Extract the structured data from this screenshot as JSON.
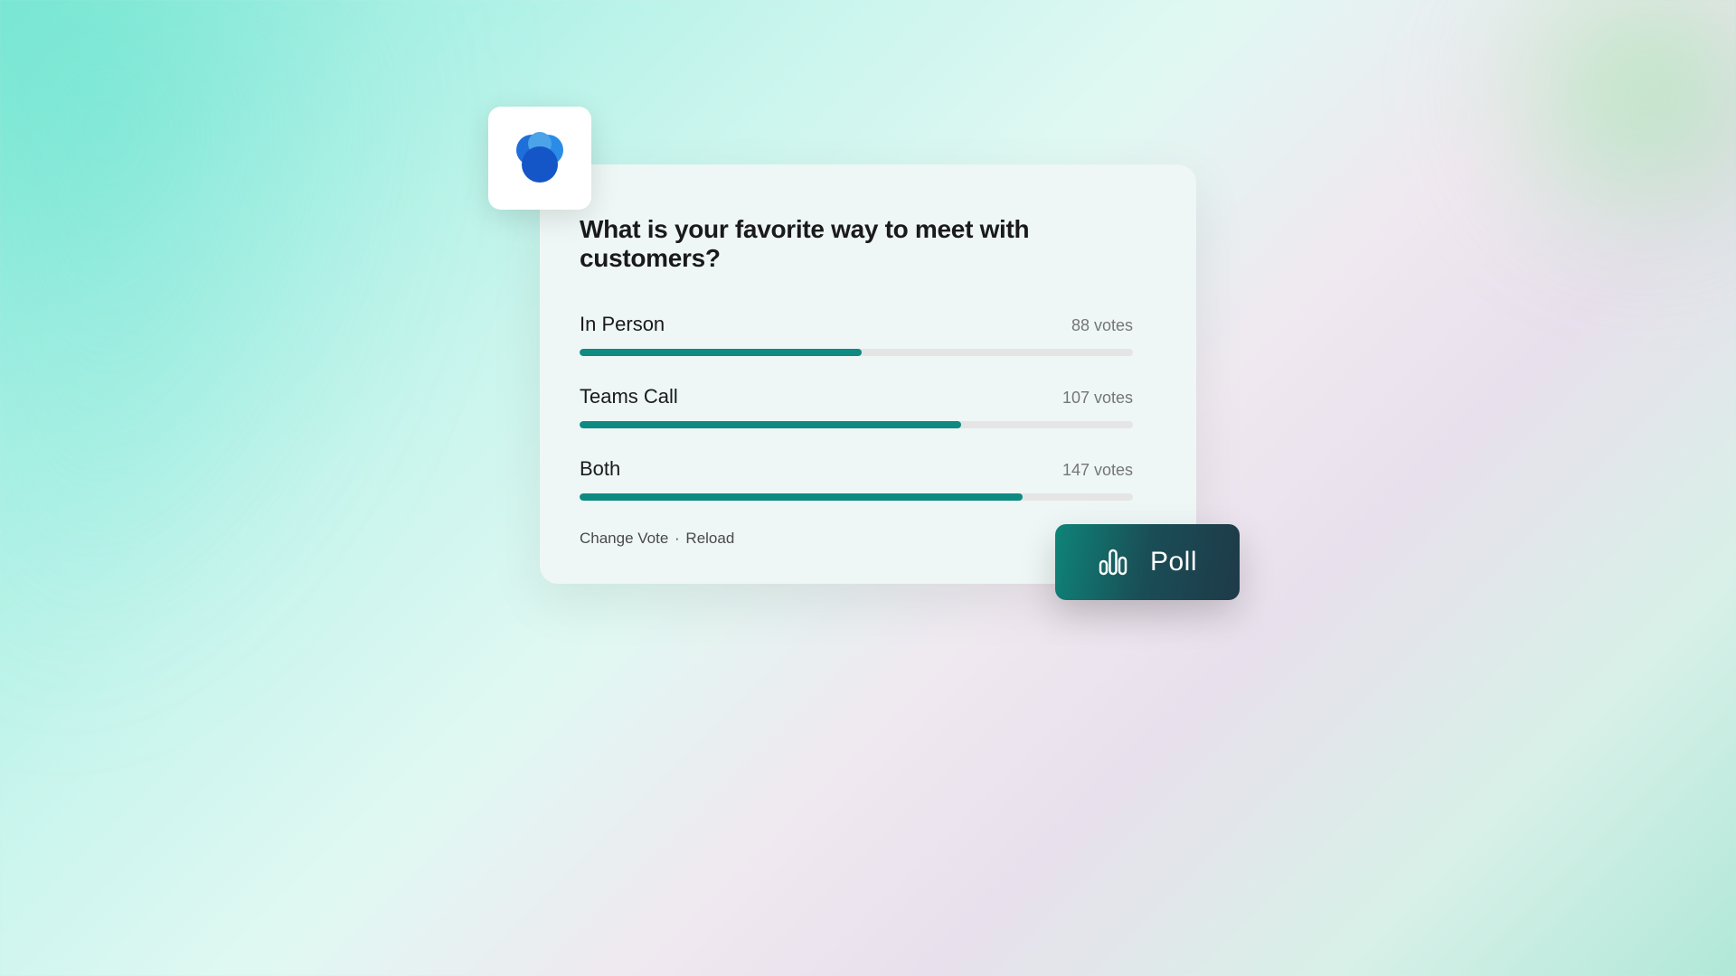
{
  "poll": {
    "question": "What is your favorite way to meet with customers?",
    "options": [
      {
        "label": "In Person",
        "votes_text": "88 votes",
        "votes": 88
      },
      {
        "label": "Teams Call",
        "votes_text": "107 votes",
        "votes": 107
      },
      {
        "label": "Both",
        "votes_text": "147 votes",
        "votes": 147
      }
    ],
    "actions": {
      "change_vote": "Change Vote",
      "separator": " · ",
      "reload": "Reload"
    }
  },
  "button": {
    "label": "Poll"
  },
  "icon": {
    "name": "app-logo"
  },
  "chart_data": {
    "type": "bar",
    "title": "What is your favorite way to meet with customers?",
    "categories": [
      "In Person",
      "Teams Call",
      "Both"
    ],
    "values": [
      88,
      107,
      147
    ],
    "xlabel": "",
    "ylabel": "votes",
    "ylim": [
      0,
      180
    ]
  }
}
